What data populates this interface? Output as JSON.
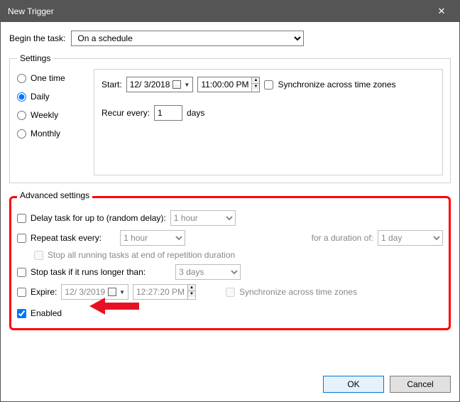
{
  "window": {
    "title": "New Trigger",
    "close": "✕"
  },
  "begin": {
    "label": "Begin the task:",
    "value": "On a schedule"
  },
  "settings": {
    "legend": "Settings",
    "radios": {
      "one_time": "One time",
      "daily": "Daily",
      "weekly": "Weekly",
      "monthly": "Monthly"
    },
    "selected": "daily",
    "start_label": "Start:",
    "start_date": "12/  3/2018",
    "start_time": "11:00:00 PM",
    "sync_label": "Synchronize across time zones",
    "recur_label": "Recur every:",
    "recur_value": "1",
    "recur_unit": "days"
  },
  "advanced": {
    "legend": "Advanced settings",
    "delay_label": "Delay task for up to (random delay):",
    "delay_value": "1 hour",
    "repeat_label": "Repeat task every:",
    "repeat_value": "1 hour",
    "duration_label": "for a duration of:",
    "duration_value": "1 day",
    "stop_all_label": "Stop all running tasks at end of repetition duration",
    "stop_longer_label": "Stop task if it runs longer than:",
    "stop_longer_value": "3 days",
    "expire_label": "Expire:",
    "expire_date": "12/  3/2019",
    "expire_time": "12:27:20 PM",
    "expire_sync_label": "Synchronize across time zones",
    "enabled_label": "Enabled"
  },
  "buttons": {
    "ok": "OK",
    "cancel": "Cancel"
  }
}
